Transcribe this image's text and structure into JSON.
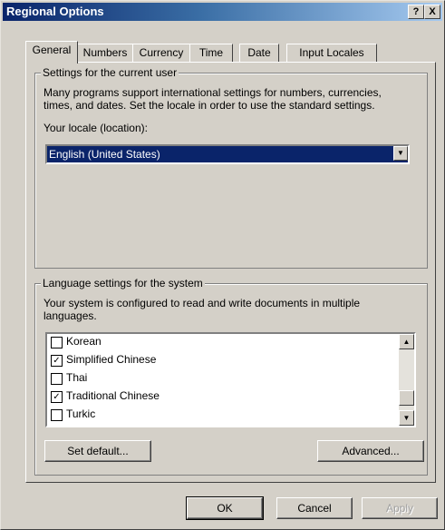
{
  "window": {
    "title": "Regional Options",
    "help_label": "?",
    "close_label": "X"
  },
  "tabs": [
    {
      "label": "General",
      "active": true
    },
    {
      "label": "Numbers",
      "active": false
    },
    {
      "label": "Currency",
      "active": false
    },
    {
      "label": "Time",
      "active": false
    },
    {
      "label": "Date",
      "active": false
    },
    {
      "label": "Input Locales",
      "active": false
    }
  ],
  "user_settings": {
    "legend": "Settings for the current user",
    "description_line1": "Many programs support international settings for numbers, currencies,",
    "description_line2": "times, and dates. Set the locale in order to use the standard settings.",
    "locale_label": "Your locale (location):",
    "locale_value": "English (United States)"
  },
  "system_settings": {
    "legend": "Language settings for the system",
    "description_line1": "Your system is configured to read and write documents in multiple",
    "description_line2": "languages.",
    "languages": [
      {
        "name": "Korean",
        "checked": false
      },
      {
        "name": "Simplified Chinese",
        "checked": true
      },
      {
        "name": "Thai",
        "checked": false
      },
      {
        "name": "Traditional Chinese",
        "checked": true
      },
      {
        "name": "Turkic",
        "checked": false
      }
    ],
    "set_default_label": "Set default...",
    "advanced_label": "Advanced..."
  },
  "footer": {
    "ok_label": "OK",
    "cancel_label": "Cancel",
    "apply_label": "Apply"
  },
  "icons": {
    "check": "✓",
    "arrow_up": "▲",
    "arrow_down": "▼"
  }
}
